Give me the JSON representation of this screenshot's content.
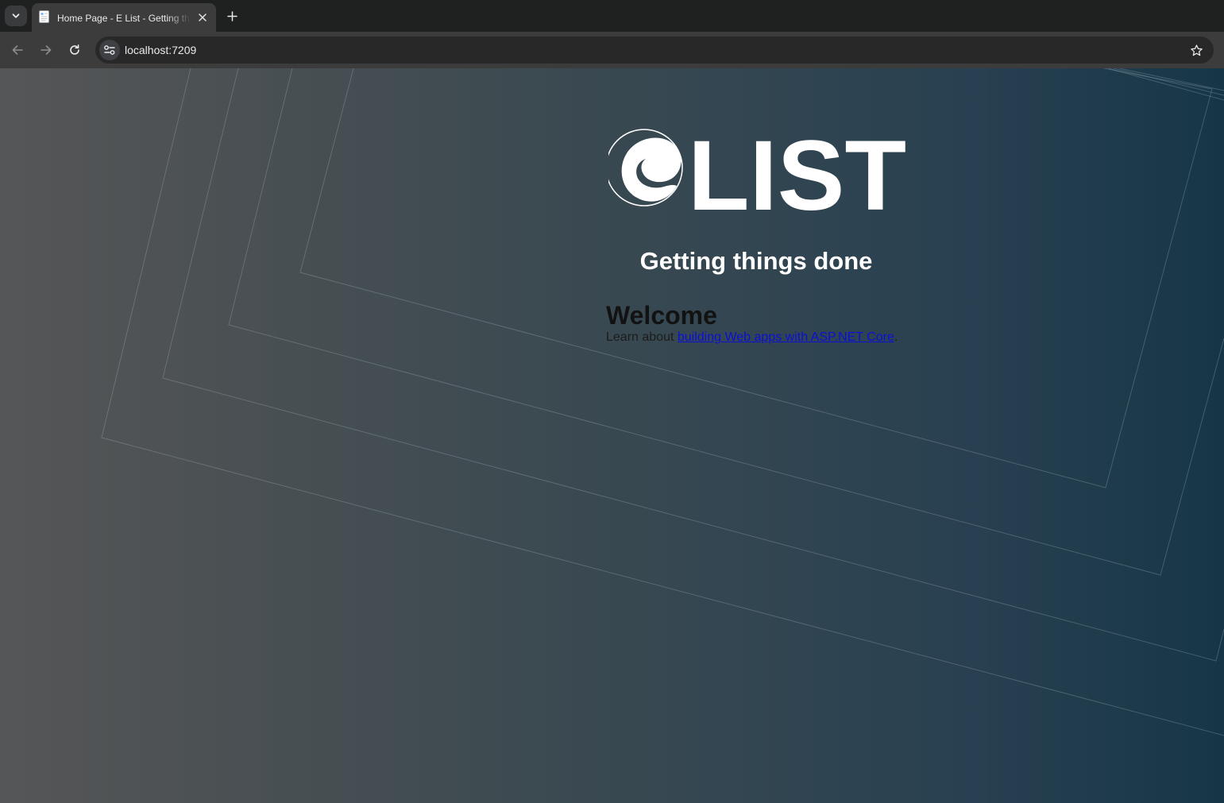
{
  "browser": {
    "tab": {
      "title": "Home Page - E List - Getting things done"
    },
    "omnibox": {
      "url": "localhost:7209"
    },
    "icons": [
      "tab-search-icon",
      "page-favicon-icon",
      "close-icon",
      "plus-icon",
      "back-arrow-icon",
      "forward-arrow-icon",
      "reload-icon",
      "site-settings-icon",
      "star-icon"
    ]
  },
  "page": {
    "logo": {
      "text": "LIST",
      "mark": "e-swirl-logo"
    },
    "tagline": "Getting things done",
    "welcome": {
      "heading": "Welcome",
      "learn_prefix": "Learn about ",
      "learn_link": "building Web apps with ASP.NET Core",
      "learn_suffix": "."
    },
    "colors": {
      "gradient_left": "#555657",
      "gradient_right": "#163647",
      "link": "#0c0fd6",
      "heading_dark": "#121212"
    }
  }
}
